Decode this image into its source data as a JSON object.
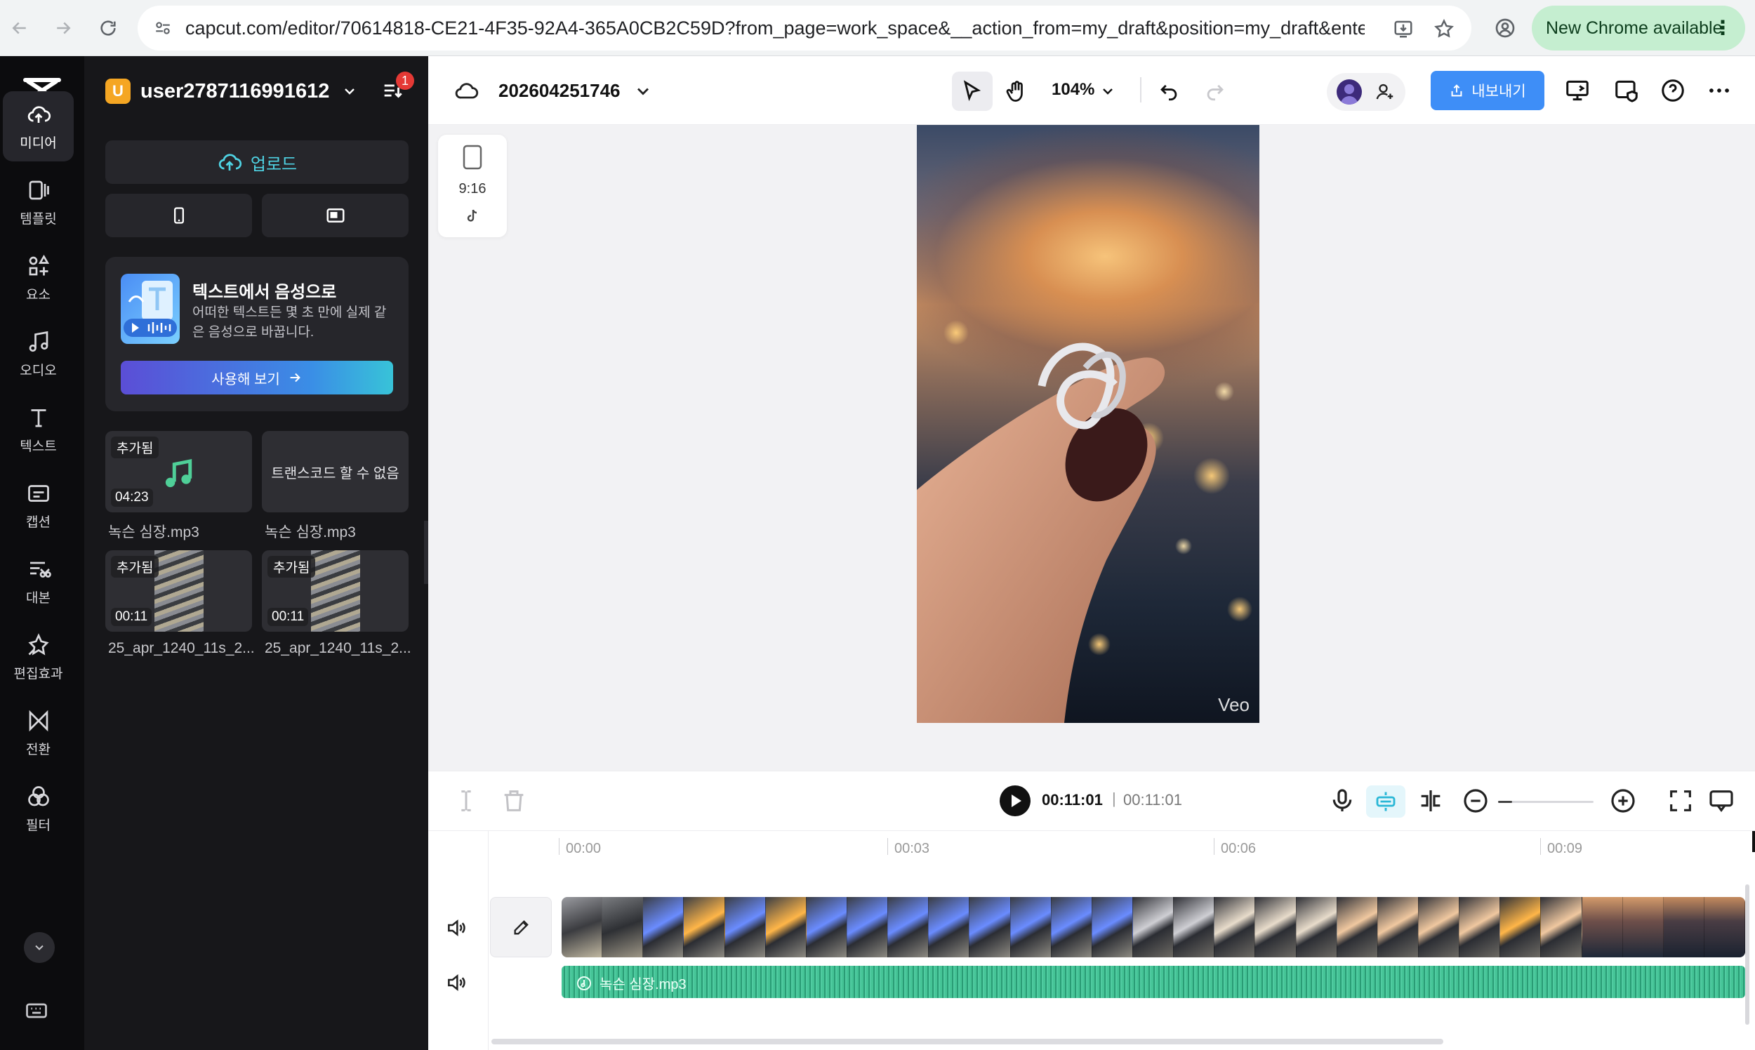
{
  "browser": {
    "url": "capcut.com/editor/70614818-CE21-4F35-92A4-365A0CB2C59D?from_page=work_space&__action_from=my_draft&position=my_draft&enter_f...",
    "update_label": "New Chrome available"
  },
  "rail": {
    "items": [
      {
        "label": "미디어",
        "icon": "cloud-upload-icon",
        "active": true
      },
      {
        "label": "템플릿",
        "icon": "template-icon"
      },
      {
        "label": "요소",
        "icon": "elements-icon"
      },
      {
        "label": "오디오",
        "icon": "music-note-icon"
      },
      {
        "label": "텍스트",
        "icon": "text-t-icon"
      },
      {
        "label": "캡션",
        "icon": "captions-icon"
      },
      {
        "label": "대본",
        "icon": "script-icon"
      },
      {
        "label": "편집효과",
        "icon": "effects-sparkle-icon"
      },
      {
        "label": "전환",
        "icon": "transition-icon"
      },
      {
        "label": "필터",
        "icon": "filter-circles-icon"
      }
    ]
  },
  "panel": {
    "workspace_initial": "U",
    "workspace_name": "user2787116991612'...",
    "notification_count": "1",
    "upload_label": "업로드",
    "promo": {
      "title": "텍스트에서 음성으로",
      "description": "어떠한 텍스트든 몇 초 만에 실제 같은 음성으로 바꿉니다.",
      "button_label": "사용해 보기"
    },
    "media": [
      {
        "tag": "추가됨",
        "duration": "04:23",
        "name": "녹슨 심장.mp3",
        "kind": "audio"
      },
      {
        "overlay": "트랜스코드 할 수 없음",
        "name": "녹슨 심장.mp3",
        "kind": "error"
      },
      {
        "tag": "추가됨",
        "duration": "00:11",
        "name": "25_apr_1240_11s_2...",
        "kind": "video"
      },
      {
        "tag": "추가됨",
        "duration": "00:11",
        "name": "25_apr_1240_11s_2...",
        "kind": "video"
      }
    ]
  },
  "topbar": {
    "project_name": "202604251746",
    "zoom": "104%",
    "export_label": "내보내기"
  },
  "canvas": {
    "ratio_label": "9:16",
    "watermark": "Veo"
  },
  "timeline": {
    "current_time": "00:11:01",
    "separator": "|",
    "total_time": "00:11:01",
    "zoom_level": 0.0,
    "ruler": [
      "00:00",
      "00:03",
      "00:06",
      "00:09"
    ],
    "audio_clip_name": "녹슨 심장.mp3"
  }
}
